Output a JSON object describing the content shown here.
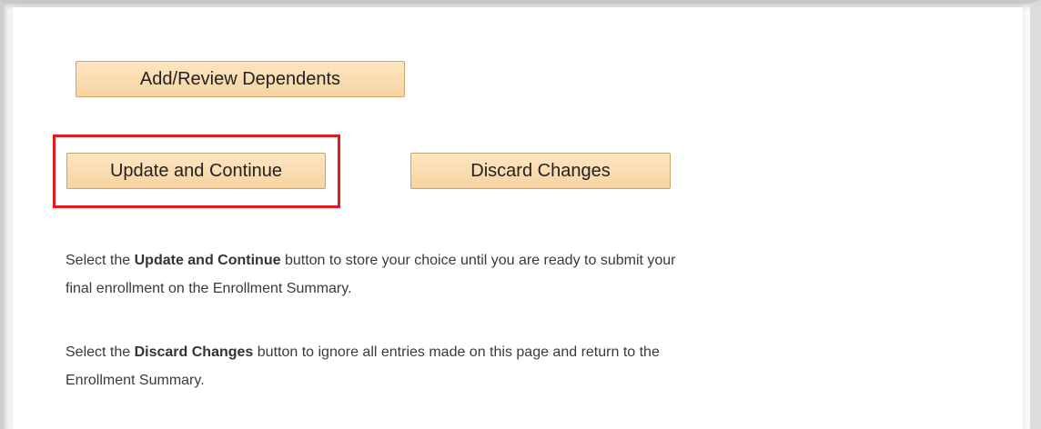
{
  "buttons": {
    "add_review_dependents": "Add/Review Dependents",
    "update_and_continue": "Update and Continue",
    "discard_changes": "Discard Changes"
  },
  "instructions": {
    "update": {
      "prefix": "Select the ",
      "button_name": "Update and Continue",
      "line1_suffix": " button to store your choice until you are ready to submit your",
      "line2": "final enrollment on the Enrollment Summary."
    },
    "discard": {
      "prefix": "Select the ",
      "button_name": "Discard Changes",
      "line1_suffix": " button to ignore all entries made on this page and return to the",
      "line2": "Enrollment Summary."
    }
  },
  "colors": {
    "button_bg": "#f9dbb0",
    "button_border": "#c9a46c",
    "highlight_border": "#e21b23",
    "text": "#3a3a3a"
  }
}
